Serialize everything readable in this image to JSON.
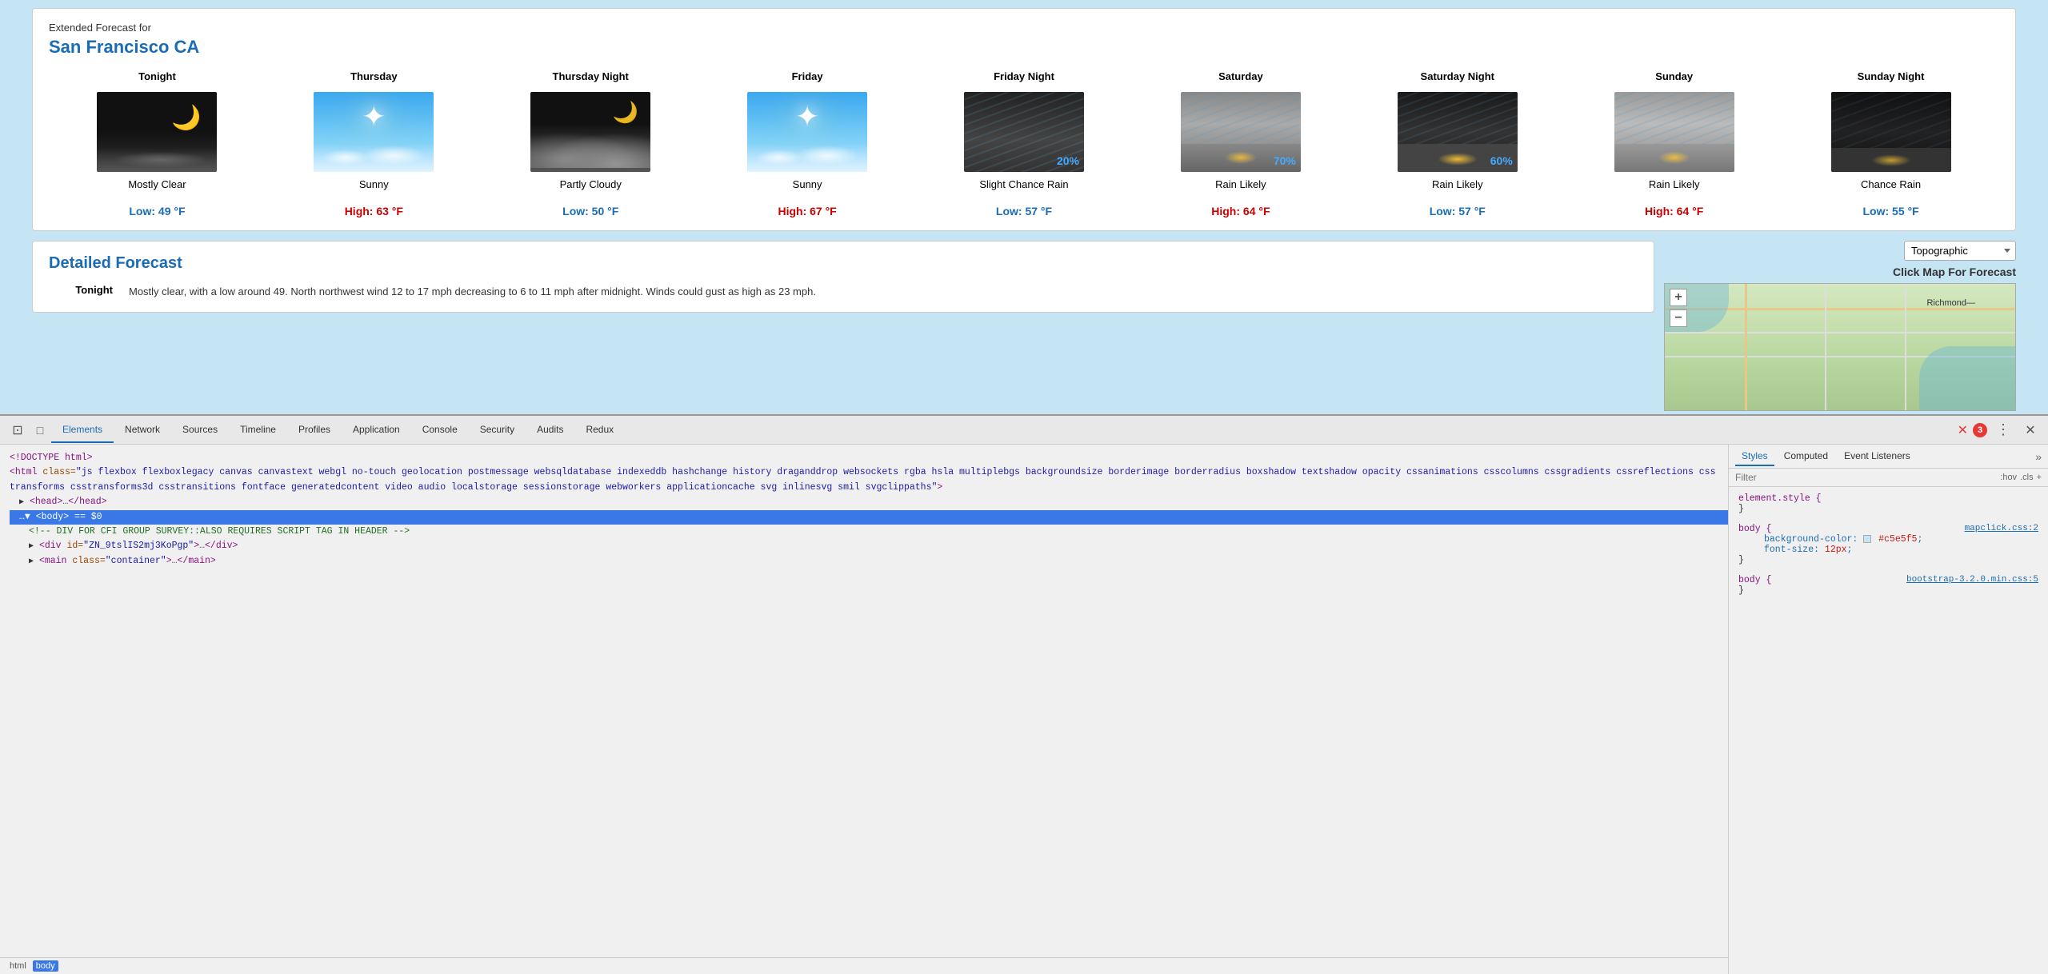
{
  "header": {
    "extended_label": "Extended Forecast for",
    "location": "San Francisco CA"
  },
  "forecast_days": [
    {
      "label": "Tonight",
      "image_type": "mostly-clear",
      "condition": "Mostly Clear",
      "temp_label": "Low: 49 °F",
      "temp_type": "low"
    },
    {
      "label": "Thursday",
      "image_type": "sunny",
      "condition": "Sunny",
      "temp_label": "High: 63 °F",
      "temp_type": "high"
    },
    {
      "label": "Thursday Night",
      "image_type": "partly-cloudy",
      "condition": "Partly Cloudy",
      "temp_label": "Low: 50 °F",
      "temp_type": "low"
    },
    {
      "label": "Friday",
      "image_type": "sunny",
      "condition": "Sunny",
      "temp_label": "High: 67 °F",
      "temp_type": "high"
    },
    {
      "label": "Friday Night",
      "image_type": "rain-slight",
      "condition": "Slight Chance Rain",
      "rain_pct": "20%",
      "temp_label": "Low: 57 °F",
      "temp_type": "low"
    },
    {
      "label": "Saturday",
      "image_type": "rain-likely-day",
      "condition": "Rain Likely",
      "rain_pct": "70%",
      "temp_label": "High: 64 °F",
      "temp_type": "high"
    },
    {
      "label": "Saturday Night",
      "image_type": "rain-likely-night",
      "condition": "Rain Likely",
      "rain_pct": "60%",
      "temp_label": "Low: 57 °F",
      "temp_type": "low"
    },
    {
      "label": "Sunday",
      "image_type": "rain-likely-day2",
      "condition": "Rain Likely",
      "temp_label": "High: 64 °F",
      "temp_type": "high"
    },
    {
      "label": "Sunday Night",
      "image_type": "chance-rain-night",
      "condition": "Chance Rain",
      "temp_label": "Low: 55 °F",
      "temp_type": "low"
    }
  ],
  "detailed": {
    "title": "Detailed Forecast",
    "rows": [
      {
        "period": "Tonight",
        "text": "Mostly clear, with a low around 49. North northwest wind 12 to 17 mph decreasing to 6 to 11 mph after midnight. Winds could gust as high as 23 mph."
      }
    ]
  },
  "map": {
    "dropdown_label": "Topographic",
    "click_label": "Click Map For Forecast",
    "zoom_plus": "+",
    "zoom_minus": "−",
    "location_label": "Richmond—"
  },
  "devtools": {
    "tabs": [
      "Elements",
      "Network",
      "Sources",
      "Timeline",
      "Profiles",
      "Application",
      "Console",
      "Security",
      "Audits",
      "Redux"
    ],
    "active_tab": "Elements",
    "error_count": "3",
    "styles_tabs": [
      "Styles",
      "Computed",
      "Event Listeners"
    ],
    "active_styles_tab": "Styles",
    "filter_placeholder": "Filter",
    "hov_label": ":hov",
    "cls_label": ".cls",
    "add_label": "+",
    "html_lines": [
      "<!DOCTYPE html>",
      "<html class=\"js flexbox flexboxlegacy canvas canvastext webgl no-touch geolocation postmessage websqldatabase indexeddb hashchange history draganddrop websockets rgba hsla multiplebgs backgroundsize borderimage borderradius boxshadow textshadow opacity cssanimations csscolumns cssgradients cssreflections csstransforms csstransforms3d csstransitions fontface generatedcontent video audio localstorage sessionstorage webworkers applicationcache svg inlinesvg smil svgclippaths\">",
      "▶ <head>…</head>",
      "▼ <body> == $0",
      "<!-- DIV FOR CFI GROUP SURVEY::ALSO REQUIRES SCRIPT TAG IN HEADER -->",
      "▶ <div id=\"ZN_9tslIS2mj3KoPgp\">…</div>",
      "▶ <main class=\"container\">…</main>"
    ],
    "breadcrumb": [
      "html",
      "body"
    ],
    "css_rules": [
      {
        "selector": "element.style {",
        "props": []
      },
      {
        "selector": "body {",
        "props": [
          {
            "prop": "background-color:",
            "value": "#c5e5f5",
            "has_swatch": true
          },
          {
            "prop": "font-size:",
            "value": "12px"
          }
        ],
        "source": "mapclick.css:2"
      },
      {
        "selector": "body {",
        "props": [],
        "source": "bootstrap-3.2.0.min.css:5"
      }
    ]
  }
}
